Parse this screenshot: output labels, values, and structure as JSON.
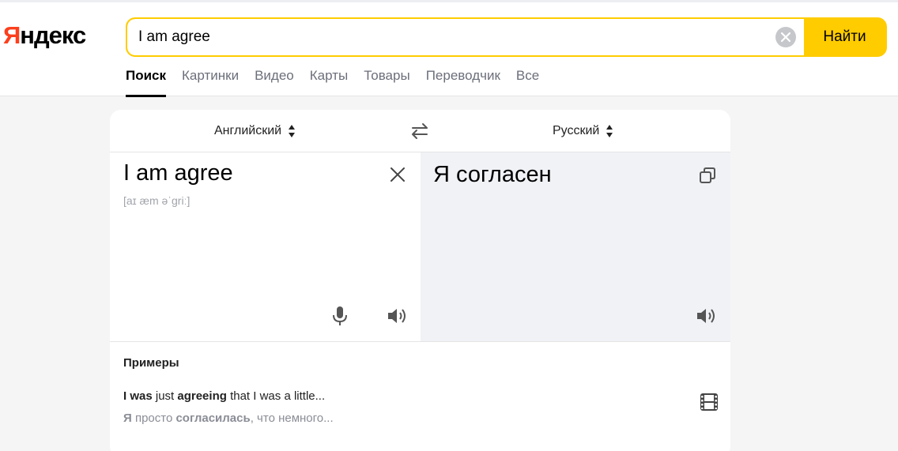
{
  "logo": {
    "first_letter": "Я",
    "rest": "ндекс"
  },
  "search": {
    "query": "I am agree",
    "button_label": "Найти"
  },
  "nav": [
    {
      "label": "Поиск",
      "active": true
    },
    {
      "label": "Картинки"
    },
    {
      "label": "Видео"
    },
    {
      "label": "Карты"
    },
    {
      "label": "Товары"
    },
    {
      "label": "Переводчик"
    },
    {
      "label": "Все"
    }
  ],
  "translator": {
    "source_lang": "Английский",
    "target_lang": "Русский",
    "source_text": "I am agree",
    "transcription": "[aɪ æm əˈɡriː]",
    "target_text": "Я согласен"
  },
  "examples": {
    "title": "Примеры",
    "source": {
      "b1": "I was",
      "t1": " just ",
      "b2": "agreeing",
      "t2": " that I was a little..."
    },
    "target": {
      "b1": "Я",
      "t1": " просто ",
      "b2": "согласилась",
      "t2": ", что немного..."
    }
  },
  "colors": {
    "accent": "#ffcc00",
    "logo_red": "#fc3f1d",
    "target_bg": "#f1f2f6"
  }
}
